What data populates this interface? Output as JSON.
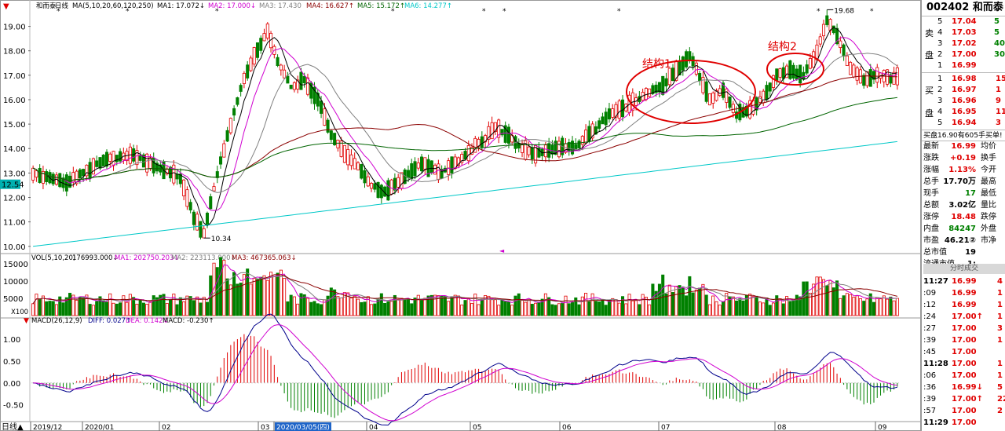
{
  "stock": {
    "code": "002402",
    "name": "和而泰"
  },
  "main_header": {
    "flag_name": "和而泰",
    "period_label": "日线",
    "ma_params": "MA(5,10,20,60,120,250)",
    "ma1": "MA1: 17.072↓",
    "ma2": "MA2: 17.000↓",
    "ma3": "MA3: 17.430",
    "ma4": "MA4: 16.627↑",
    "ma5": "MA5: 15.172↑",
    "ma6": "MA6: 14.277↑"
  },
  "vol_header": {
    "label": "VOL(5,10,20)",
    "vol": "176993.000↓",
    "ma1": "MA1: 202750.203↓",
    "ma2": "MA2: 223113.000↓",
    "ma3": "MA3: 467365.063↓"
  },
  "macd_header": {
    "label": "MACD(26,12,9)",
    "diff": "DIFF: 0.027↑",
    "dea": "DEA: 0.142↓",
    "macd": "MACD: -0.230↑"
  },
  "price_axis": [
    "19.00",
    "18.00",
    "17.00",
    "16.00",
    "15.00",
    "14.00",
    "13.00",
    "12.00",
    "11.00",
    "10.00"
  ],
  "current_price_tag": "12.54",
  "vol_axis": [
    "15000",
    "10000",
    "5000"
  ],
  "vol_unit": "X100",
  "macd_axis": [
    "1.00",
    "0.50",
    "0.00",
    "-0.50"
  ],
  "time_axis": [
    "2019/12",
    "2020/01",
    "02",
    "03",
    "2020/03/05(四)",
    "04",
    "05",
    "06",
    "07",
    "08",
    "09"
  ],
  "period_bottom_label": "日线▲",
  "annotations": {
    "high": "19.68",
    "low": "10.34",
    "struct1": "结构1",
    "struct2": "结构2"
  },
  "colors": {
    "up": "#e00000",
    "down": "#008000",
    "ma1": "#000000",
    "ma2": "#d000d0",
    "ma3": "#808080",
    "ma4": "#8b0000",
    "ma5": "#006400",
    "ma6": "#00c8c8",
    "ring": "#e00000"
  },
  "order_book": {
    "sell_label": [
      "卖",
      "盘"
    ],
    "buy_label": [
      "买",
      "盘"
    ],
    "sells": [
      {
        "level": "5",
        "price": "17.04",
        "vol": "5"
      },
      {
        "level": "4",
        "price": "17.03",
        "vol": "5"
      },
      {
        "level": "3",
        "price": "17.02",
        "vol": "40"
      },
      {
        "level": "2",
        "price": "17.00",
        "vol": "30"
      },
      {
        "level": "1",
        "price": "16.99",
        "vol": ""
      }
    ],
    "buys": [
      {
        "level": "1",
        "price": "16.98",
        "vol": "15"
      },
      {
        "level": "2",
        "price": "16.97",
        "vol": "1"
      },
      {
        "level": "3",
        "price": "16.96",
        "vol": "9"
      },
      {
        "level": "4",
        "price": "16.95",
        "vol": "11"
      },
      {
        "level": "5",
        "price": "16.94",
        "vol": "3"
      }
    ],
    "notice": "买盘16.90有605手买单!"
  },
  "quote": [
    {
      "k1": "最新",
      "v1": "16.99",
      "k2": "均价"
    },
    {
      "k1": "涨跌",
      "v1": "+0.19",
      "k2": "换手"
    },
    {
      "k1": "涨幅",
      "v1": "1.13%",
      "k2": "今开"
    },
    {
      "k1": "总手",
      "v1": "17.70万",
      "k2": "最高"
    },
    {
      "k1": "现手",
      "v1": "17",
      "k2": "最低"
    },
    {
      "k1": "总额",
      "v1": "3.02亿",
      "k2": "量比"
    },
    {
      "k1": "涨停",
      "v1": "18.48",
      "k2": "跌停"
    },
    {
      "k1": "内盘",
      "v1": "84247",
      "k2": "外盘"
    },
    {
      "k1": "市盈",
      "v1": "46.21②",
      "k2": "市净"
    },
    {
      "k1": "总市值",
      "v1": "19",
      "k2": ""
    },
    {
      "k1": "流通市值",
      "v1": "1:",
      "k2": ""
    }
  ],
  "ticks_header": "分时成交",
  "ticks": [
    {
      "t": "11:27",
      "p": "16.99",
      "v": "4"
    },
    {
      "t": ":09",
      "p": "16.99",
      "v": "1"
    },
    {
      "t": ":12",
      "p": "16.99",
      "v": "1"
    },
    {
      "t": ":24",
      "p": "17.00↑",
      "v": "1"
    },
    {
      "t": ":27",
      "p": "17.00",
      "v": "3"
    },
    {
      "t": ":39",
      "p": "17.00",
      "v": "1"
    },
    {
      "t": ":45",
      "p": "17.00",
      "v": ""
    },
    {
      "t": "11:28",
      "p": "17.00",
      "v": "1"
    },
    {
      "t": ":06",
      "p": "17.00",
      "v": "1"
    },
    {
      "t": ":36",
      "p": "16.99↓",
      "v": "5"
    },
    {
      "t": ":39",
      "p": "17.00↑",
      "v": "22"
    },
    {
      "t": ":57",
      "p": "17.00",
      "v": "2"
    },
    {
      "t": "11:29",
      "p": "17.00",
      "v": ""
    }
  ]
}
